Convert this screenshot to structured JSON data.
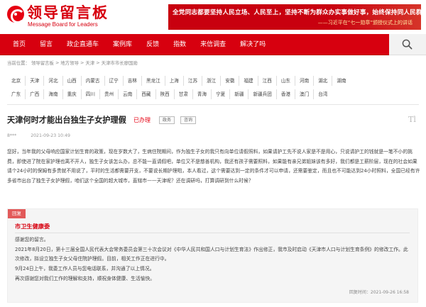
{
  "header": {
    "logo_title": "领导留言板",
    "logo_subtitle": "Message Board for Leaders",
    "banner_line1": "全党同志都要坚持人民立场、人民至上，坚持不断为群众办实事做好事，始终保持同人民群众的血肉联系。",
    "banner_line2": "——习近平在“七一勋章”颁授仪式上的讲话"
  },
  "nav": {
    "items": [
      "首页",
      "留言",
      "政企直通车",
      "案例库",
      "反馈",
      "指数",
      "来信调查",
      "解决了吗"
    ]
  },
  "breadcrumb": {
    "prefix": "当前位置：",
    "items": [
      "领导留言板",
      "地方领导",
      "天津",
      "天津市市长廖国勋"
    ],
    "separator": ">"
  },
  "regions": {
    "row1": [
      "北京",
      "天津",
      "河北",
      "山西",
      "内蒙古",
      "辽宁",
      "吉林",
      "黑龙江",
      "上海",
      "江苏",
      "浙江",
      "安徽",
      "福建",
      "江西",
      "山东",
      "河南",
      "湖北",
      "湖南"
    ],
    "row2": [
      "广东",
      "广西",
      "海南",
      "重庆",
      "四川",
      "贵州",
      "云南",
      "西藏",
      "陕西",
      "甘肃",
      "青海",
      "宁夏",
      "新疆",
      "新疆兵团",
      "香港",
      "澳门",
      "台湾"
    ]
  },
  "message": {
    "title": "天津何时才能出台独生子女护理假",
    "status": "已办理",
    "tags": [
      "政务",
      "咨询"
    ],
    "font_toggle": "Tl",
    "author": "8***",
    "time": "2021-09-23 10:49",
    "body": "您好，当年我的父母响应国家计划生育的政策，现在岁数大了，生病住院期间，作为独生子女的我只有向单位请假照料，如果请护工先不说人家是不是用心，只说请护工的钱就是一笔不小的挑费，即使进了院在家护理也离不开人，独生子女该怎么办，总不能一直请假吧，单位又不是慈善机构，我还有孩子需要照料，如果能有亲兄弟姐妹该有多好，我们都是工薪阶层，现在的社会如果请个24小时的保姆有多贵就不用说了，平时的生活都需要开支，不要说长期护理啦，本人看过，这个需要达到一定的条件才可以申请，还需要鉴定，而且也不可能达到24小时照料，全国已经有许多省市出台了独生子女护理假，咱们这个全国的超大城市，直辖市——天津呢？还在调研吗，打算调研到什么时候？"
  },
  "reply": {
    "label": "回复",
    "org": "市卫生健康委",
    "lines": [
      "感谢您的留言。",
      "2021年8月20日，第十三届全国人民代表大会常务委员会第三十次会议对《中华人民共和国人口与计划生育法》作出修正，我市及时启动《天津市人口与计划生育条例》的修改工作。此次修改，拟设立独生子女父母住院护理假。目前，相关工作正在进行中。",
      "9月24日上午，我委工作人员与您电话联系，并沟通了以上情况。",
      "再次感谢您对我们工作的理解和支持，顺祝身体健康、生活愉快。"
    ],
    "time": "回复时间：2021-09-26 16:58"
  },
  "colors": {
    "brand_red": "#d7000f",
    "status_red": "#e60012",
    "reply_label_bg": "#e25a5a"
  }
}
